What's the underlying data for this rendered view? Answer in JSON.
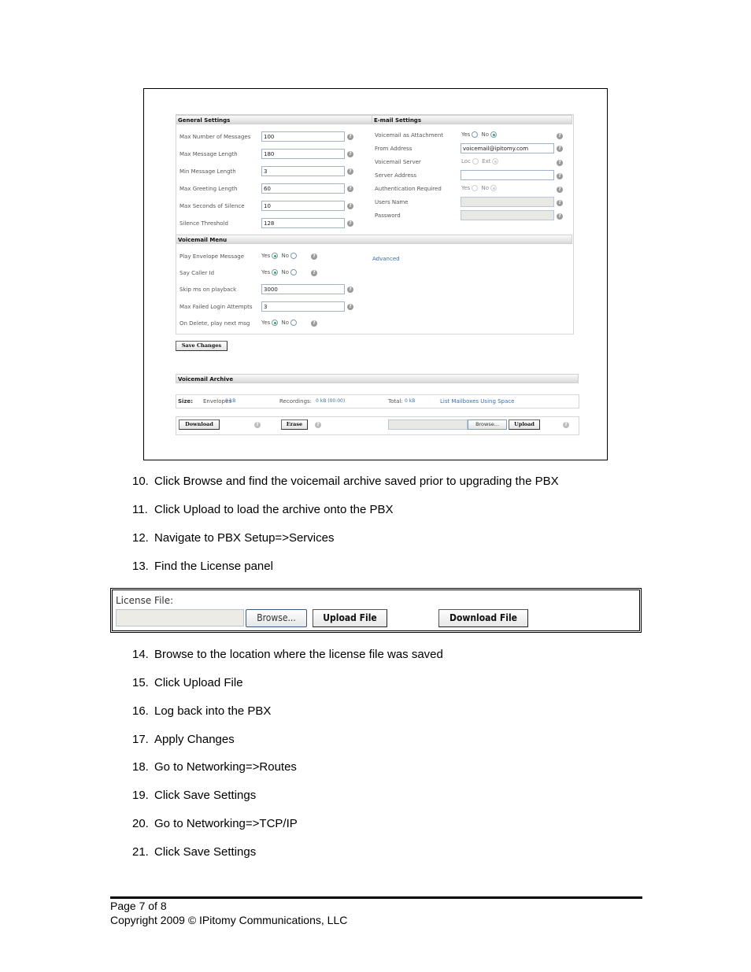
{
  "screenshot": {
    "general_settings": {
      "title": "General Settings",
      "fields": [
        {
          "label": "Max Number of Messages",
          "value": "100"
        },
        {
          "label": "Max Message Length",
          "value": "180"
        },
        {
          "label": "Min Message Length",
          "value": "3"
        },
        {
          "label": "Max Greeting Length",
          "value": "60"
        },
        {
          "label": "Max Seconds of Silence",
          "value": "10"
        },
        {
          "label": "Silence Threshold",
          "value": "128"
        }
      ]
    },
    "email_settings": {
      "title": "E-mail Settings",
      "attachment": {
        "label": "Voicemail as Attachment",
        "opt1": "Yes",
        "opt2": "No",
        "selected": "No"
      },
      "from_address": {
        "label": "From Address",
        "value": "voicemail@ipitomy.com"
      },
      "server": {
        "label": "Voicemail Server",
        "opt1": "Loc",
        "opt2": "Ext",
        "selected": "Ext"
      },
      "server_address": {
        "label": "Server Address",
        "value": ""
      },
      "auth": {
        "label": "Authentication Required",
        "opt1": "Yes",
        "opt2": "No",
        "selected": "No"
      },
      "username": {
        "label": "Users Name",
        "value": ""
      },
      "password": {
        "label": "Password",
        "value": ""
      }
    },
    "voicemail_menu": {
      "title": "Voicemail Menu",
      "envelope": {
        "label": "Play Envelope Message",
        "opt1": "Yes",
        "opt2": "No",
        "selected": "Yes"
      },
      "callerid": {
        "label": "Say Caller Id",
        "opt1": "Yes",
        "opt2": "No",
        "selected": "Yes"
      },
      "skip_ms": {
        "label": "Skip ms on playback",
        "value": "3000"
      },
      "max_failed": {
        "label": "Max Failed Login Attempts",
        "value": "3"
      },
      "on_delete": {
        "label": "On Delete, play next msg",
        "opt1": "Yes",
        "opt2": "No",
        "selected": "Yes"
      },
      "advanced_link": "Advanced"
    },
    "save_button": "Save Changes",
    "archive": {
      "title": "Voicemail Archive",
      "size_label": "Size:",
      "envelopes_label": "Envelopes",
      "envelopes_value": "0 kB",
      "recordings_label": "Recordings:",
      "recordings_value": "0 kB (00:00)",
      "total_label": "Total:",
      "total_value": "0 kB",
      "list_link": "List Mailboxes Using Space",
      "download_button": "Download",
      "erase_button": "Erase",
      "browse_button": "Browse...",
      "upload_button": "Upload"
    },
    "help_glyph": "?"
  },
  "steps_a": [
    {
      "num": "10.",
      "text": "Click Browse and find the voicemail archive saved prior to upgrading the PBX"
    },
    {
      "num": "11.",
      "text": "Click Upload to load the archive onto the PBX"
    },
    {
      "num": "12.",
      "text": "Navigate to PBX Setup=>Services"
    },
    {
      "num": "13.",
      "text": "Find the License panel"
    }
  ],
  "license_panel": {
    "label": "License File:",
    "browse_button": "Browse...",
    "upload_button": "Upload File",
    "download_button": "Download File"
  },
  "steps_b": [
    {
      "num": "14.",
      "text": "Browse to the location where the license file was saved"
    },
    {
      "num": "15.",
      "text": "Click Upload File"
    },
    {
      "num": "16.",
      "text": "Log back into the PBX"
    },
    {
      "num": "17.",
      "text": "Apply Changes"
    },
    {
      "num": "18.",
      "text": "Go to Networking=>Routes"
    },
    {
      "num": "19.",
      "text": "Click Save Settings"
    },
    {
      "num": "20.",
      "text": "Go to Networking=>TCP/IP"
    },
    {
      "num": "21.",
      "text": "Click Save Settings"
    }
  ],
  "footer": {
    "page": "Page 7 of 8",
    "copyright": "Copyright 2009 © IPitomy Communications, LLC"
  }
}
